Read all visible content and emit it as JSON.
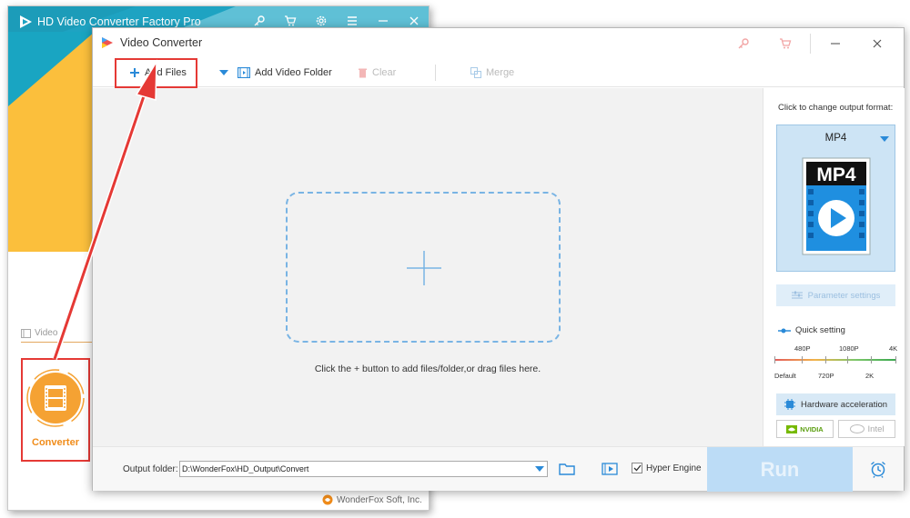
{
  "main_window": {
    "title": "HD Video Converter Factory Pro",
    "video_label": "Video",
    "converter_label": "Converter",
    "brand": "WonderFox Soft, Inc."
  },
  "converter_window": {
    "title": "Video Converter",
    "toolbar": {
      "add_files": "Add Files",
      "add_video_folder": "Add Video Folder",
      "clear": "Clear",
      "merge": "Merge"
    },
    "drop_hint": "Click the + button to add files/folder,or drag files here.",
    "side_panel": {
      "caption": "Click to change output format:",
      "format": "MP4",
      "format_badge": "MP4",
      "parameter_settings": "Parameter settings",
      "quick_setting": "Quick setting",
      "quality_top": [
        "480P",
        "1080P",
        "4K"
      ],
      "quality_bottom": [
        "Default",
        "720P",
        "2K"
      ],
      "hardware_acceleration": "Hardware acceleration",
      "nvidia": "NVIDIA",
      "intel": "Intel"
    },
    "bottom": {
      "output_label": "Output folder:",
      "output_path": "D:\\WonderFox\\HD_Output\\Convert",
      "hyper_engine": "Hyper Engine",
      "hyper_engine_checked": true,
      "run": "Run"
    }
  },
  "colors": {
    "accent_blue": "#2a8ad8",
    "highlight_red": "#e53935",
    "converter_orange": "#f08c1a",
    "run_button": "#bcdcf6"
  }
}
